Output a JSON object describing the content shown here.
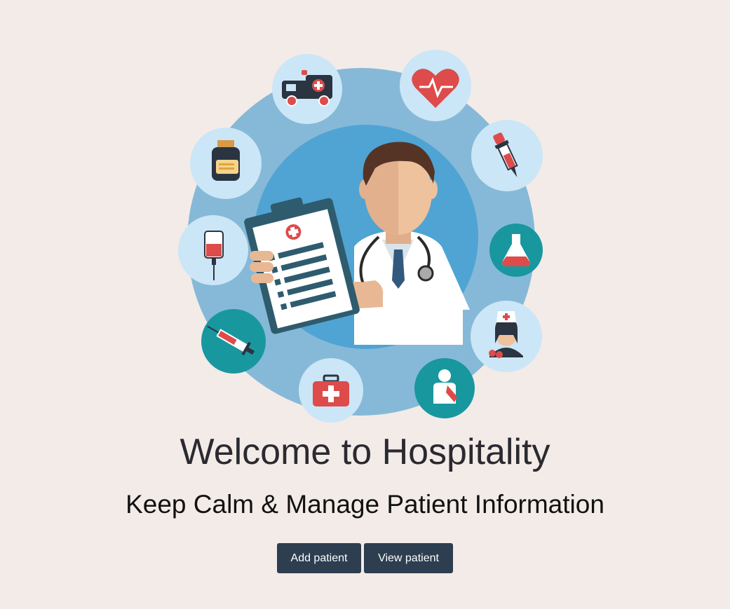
{
  "hero": {
    "illustration": "doctor-with-clipboard-and-medical-icons",
    "icons": [
      "ambulance-icon",
      "heart-pulse-icon",
      "medicine-bottle-icon",
      "dropper-icon",
      "iv-bag-icon",
      "flask-icon",
      "syringe-icon",
      "nurse-icon",
      "first-aid-kit-icon",
      "injured-patient-icon"
    ],
    "colors": {
      "outer_ring": "#86b9d8",
      "inner_circle": "#4fa4d3",
      "icon_bg_light": "#cbe6f7",
      "icon_bg_teal": "#18979f",
      "accent_red": "#dd4b4b"
    }
  },
  "title": "Welcome to Hospitality",
  "subtitle": "Keep Calm & Manage Patient Information",
  "actions": {
    "add_label": "Add patient",
    "view_label": "View patient"
  },
  "colors": {
    "page_bg": "#f3ebe8",
    "button_bg": "#2d3e50",
    "button_text": "#ffffff"
  }
}
